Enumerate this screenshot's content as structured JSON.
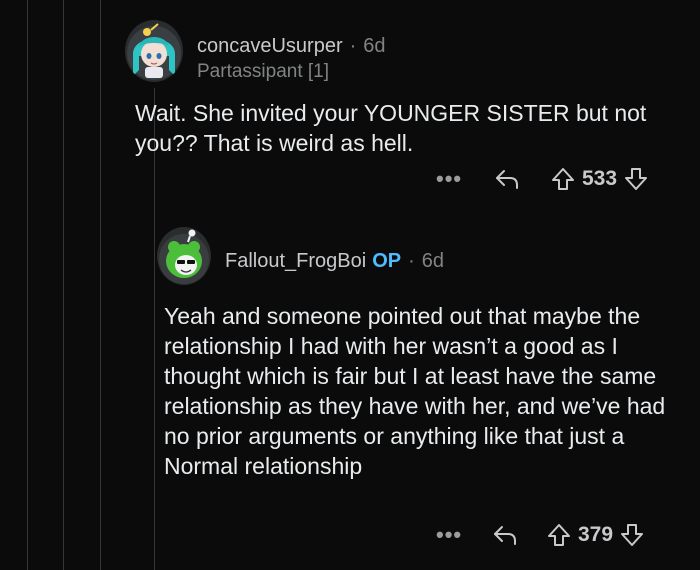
{
  "comments": [
    {
      "username": "concaveUsurper",
      "separator": "·",
      "age": "6d",
      "flair": "Partassipant [1]",
      "body": "Wait. She invited your YOUNGER SISTER but not you?? That is weird as hell.",
      "more_label": "•••",
      "score": "533",
      "avatar_icon": "anime-girl-avatar-icon"
    },
    {
      "username": "Fallout_FrogBoi",
      "op_badge": "OP",
      "separator": "·",
      "age": "6d",
      "body": "Yeah and someone pointed out that maybe the relationship I had with her wasn’t a good as I thought which is fair but I at least have the same relationship as they have with her, and we’ve had no prior arguments or anything like that just a Normal relationship",
      "more_label": "•••",
      "score": "379",
      "avatar_icon": "frog-avatar-icon"
    }
  ],
  "colors": {
    "background": "#0b0b0b",
    "op_badge": "#4fbcff",
    "muted": "#818384",
    "text": "#e9ecee"
  }
}
